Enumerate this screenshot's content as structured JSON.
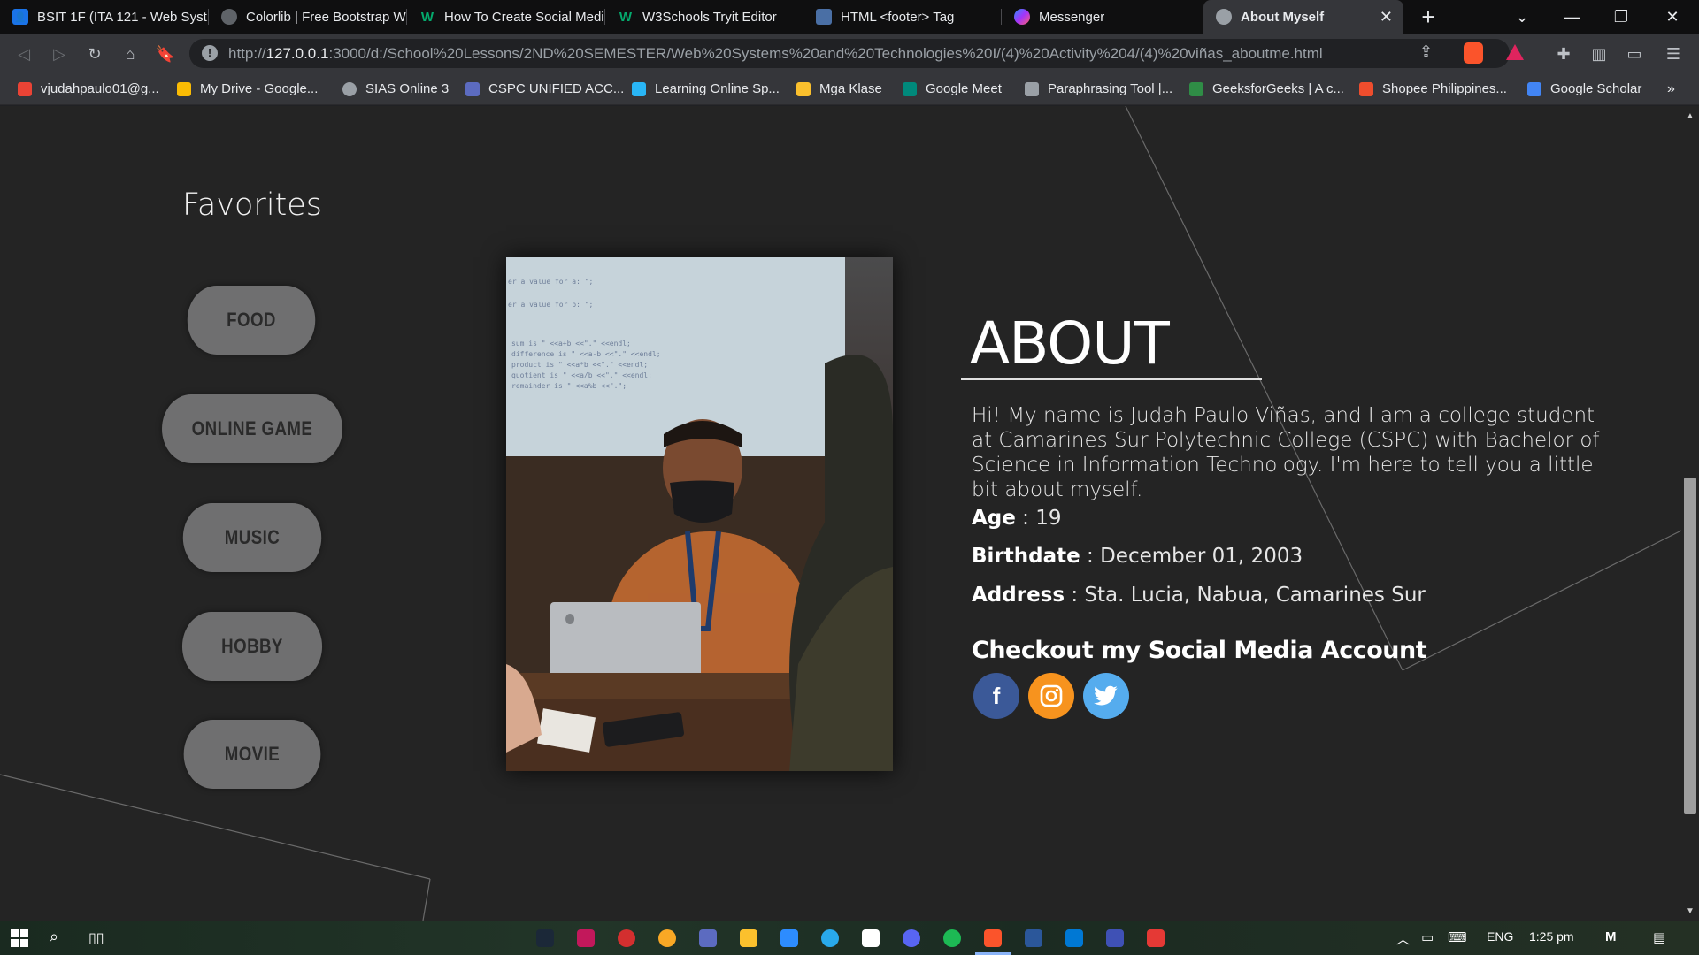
{
  "tabs": [
    {
      "title": "BSIT 1F (ITA 121 - Web Syst",
      "icon": "classroom-icon",
      "color": "#1a73e8"
    },
    {
      "title": "Colorlib | Free Bootstrap W",
      "icon": "globe-icon",
      "color": "#5f6368"
    },
    {
      "title": "How To Create Social Medi",
      "icon": "w3schools-icon",
      "color": "#04aa6d"
    },
    {
      "title": "W3Schools Tryit Editor",
      "icon": "w3schools-icon",
      "color": "#04aa6d"
    },
    {
      "title": "HTML <footer> Tag",
      "icon": "tag-icon",
      "color": "#4a6fa5"
    },
    {
      "title": "Messenger",
      "icon": "messenger-icon",
      "color": "#a334fa"
    },
    {
      "title": "About Myself",
      "icon": "globe-icon",
      "color": "#5f6368",
      "active": true
    }
  ],
  "toolbar": {
    "url_host": "127.0.0.1",
    "url_prefix": "http://",
    "url_rest": ":3000/d:/School%20Lessons/2ND%20SEMESTER/Web%20Systems%20and%20Technologies%20I/(4)%20Activity%204/(4)%20viñas_aboutme.html"
  },
  "bookmarks": [
    {
      "label": "vjudahpaulo01@g...",
      "icon": "gmail-icon",
      "color": "#ea4335"
    },
    {
      "label": "My Drive - Google...",
      "icon": "drive-icon",
      "color": "#fbbc04"
    },
    {
      "label": "SIAS Online 3",
      "icon": "globe-icon",
      "color": "#9aa0a6"
    },
    {
      "label": "CSPC UNIFIED ACC...",
      "icon": "cspc-icon",
      "color": "#5c6bc0"
    },
    {
      "label": "Learning Online Sp...",
      "icon": "learning-icon",
      "color": "#29b6f6"
    },
    {
      "label": "Mga Klase",
      "icon": "classroom-icon",
      "color": "#fbc02d"
    },
    {
      "label": "Google Meet",
      "icon": "meet-icon",
      "color": "#00897b"
    },
    {
      "label": "Paraphrasing Tool |...",
      "icon": "quill-icon",
      "color": "#9aa0a6"
    },
    {
      "label": "GeeksforGeeks | A c...",
      "icon": "gfg-icon",
      "color": "#2f8d46"
    },
    {
      "label": "Shopee Philippines...",
      "icon": "shopee-icon",
      "color": "#ee4d2d"
    },
    {
      "label": "Google Scholar",
      "icon": "scholar-icon",
      "color": "#4285f4"
    }
  ],
  "page": {
    "favorites_title": "Favorites",
    "favorites": [
      "FOOD",
      "ONLINE GAME",
      "MUSIC",
      "HOBBY",
      "MOVIE"
    ],
    "about_title": "ABOUT",
    "about_text": "Hi! My name is Judah Paulo Viñas, and I am a college student at Camarines Sur Polytechnic College (CSPC) with Bachelor of Science in Information Technology. I'm here to tell you a little bit about myself.",
    "age_label": "Age",
    "age_value": " : 19",
    "birthdate_label": "Birthdate",
    "birthdate_value": " : December 01, 2003",
    "address_label": "Address",
    "address_value": " : Sta. Lucia, Nabua, Camarines Sur",
    "social_title": "Checkout my Social Media Account",
    "social": [
      {
        "name": "facebook",
        "glyph": "f",
        "color": "#3b5998"
      },
      {
        "name": "instagram",
        "glyph": "◎",
        "color": "#f7931e"
      },
      {
        "name": "twitter",
        "glyph": "🕊",
        "color": "#55acee"
      }
    ]
  },
  "taskbar": {
    "language": "ENG",
    "time": "1:25 pm"
  }
}
